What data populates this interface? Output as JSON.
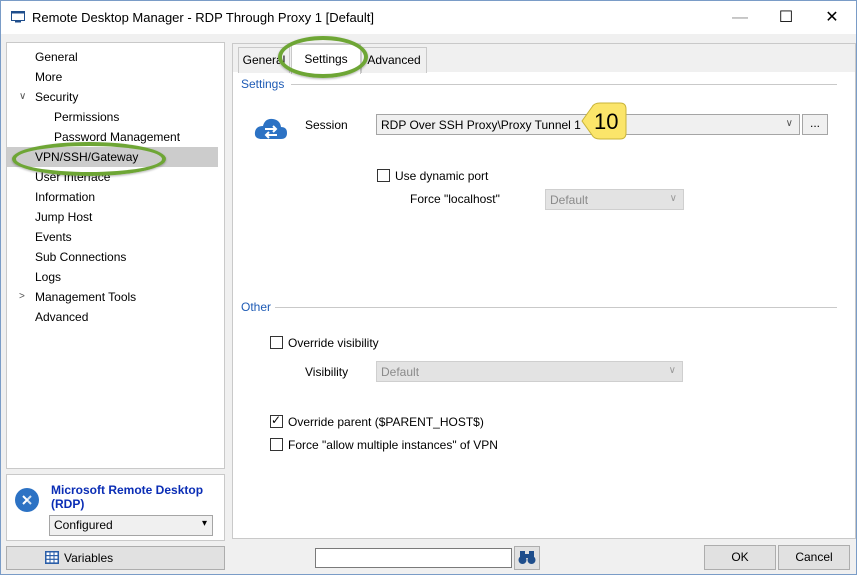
{
  "window": {
    "title": "Remote Desktop Manager - RDP Through Proxy 1 [Default]",
    "minimize_glyph": "—",
    "maximize_glyph": "☐",
    "close_glyph": "✕"
  },
  "nav": {
    "items": [
      {
        "label": "General"
      },
      {
        "label": "More"
      },
      {
        "label": "Security",
        "expanded": true
      },
      {
        "label": "Permissions"
      },
      {
        "label": "Password Management"
      },
      {
        "label": "VPN/SSH/Gateway",
        "selected": true
      },
      {
        "label": "User Interface"
      },
      {
        "label": "Information"
      },
      {
        "label": "Jump Host"
      },
      {
        "label": "Events"
      },
      {
        "label": "Sub Connections"
      },
      {
        "label": "Logs"
      },
      {
        "label": "Management Tools",
        "expanded": false
      },
      {
        "label": "Advanced"
      }
    ],
    "expand_glyph": "∨",
    "collapsed_glyph": ">"
  },
  "entry_type": {
    "title": "Microsoft Remote Desktop (RDP)",
    "status_selected": "Configured",
    "icon": "rdp-icon"
  },
  "variables_label": "Variables",
  "tabs": [
    {
      "label": "General"
    },
    {
      "label": "Settings",
      "active": true
    },
    {
      "label": "Advanced"
    }
  ],
  "settings": {
    "section_label": "Settings",
    "session_label": "Session",
    "session_value": "RDP Over SSH Proxy\\Proxy Tunnel 1",
    "dots_label": "...",
    "use_dynamic_port_label": "Use dynamic port",
    "use_dynamic_port_checked": false,
    "force_localhost_label": "Force \"localhost\"",
    "force_localhost_value": "Default"
  },
  "other": {
    "section_label": "Other",
    "override_visibility_label": "Override visibility",
    "override_visibility_checked": false,
    "visibility_label": "Visibility",
    "visibility_value": "Default",
    "override_parent_label": "Override parent ($PARENT_HOST$)",
    "override_parent_checked": true,
    "force_multiple_label": "Force \"allow multiple instances\" of VPN",
    "force_multiple_checked": false
  },
  "footer": {
    "search_value": "",
    "ok_label": "OK",
    "cancel_label": "Cancel"
  },
  "callout": {
    "number": "10"
  },
  "colors": {
    "accent": "#1e5bb5",
    "highlight_ring": "#6ea635",
    "callout_fill": "#fbe56a",
    "selected_bg": "#cccccc"
  }
}
